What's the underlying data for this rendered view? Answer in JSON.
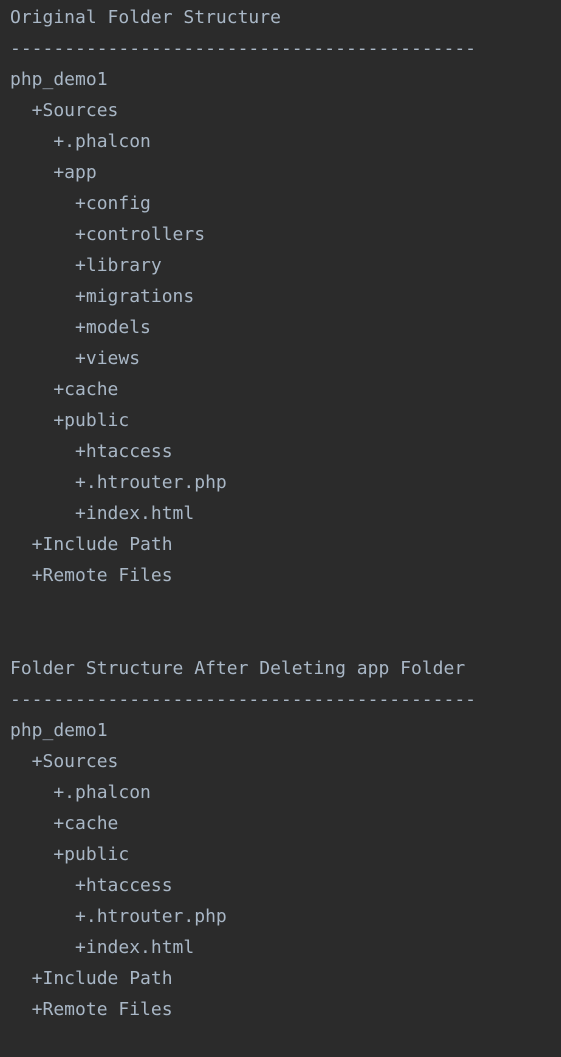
{
  "lines": [
    "Original Folder Structure",
    "-------------------------------------------",
    "php_demo1",
    "  +Sources",
    "    +.phalcon",
    "    +app",
    "      +config",
    "      +controllers",
    "      +library",
    "      +migrations",
    "      +models",
    "      +views",
    "    +cache",
    "    +public",
    "      +htaccess",
    "      +.htrouter.php",
    "      +index.html",
    "  +Include Path",
    "  +Remote Files",
    "",
    "",
    "Folder Structure After Deleting app Folder",
    "-------------------------------------------",
    "php_demo1",
    "  +Sources",
    "    +.phalcon",
    "    +cache",
    "    +public",
    "      +htaccess",
    "      +.htrouter.php",
    "      +index.html",
    "  +Include Path",
    "  +Remote Files"
  ]
}
